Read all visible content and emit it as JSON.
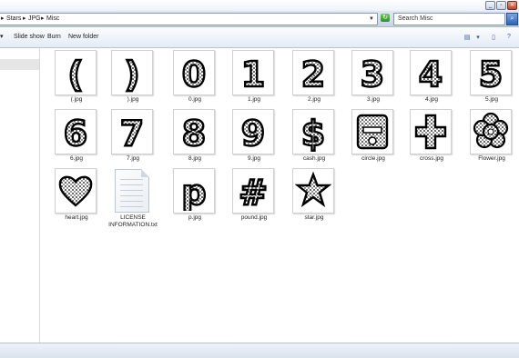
{
  "address": {
    "crumbs": [
      "Stars",
      "JPG",
      "Misc"
    ],
    "separator": "▸"
  },
  "search": {
    "placeholder": "Search Misc"
  },
  "toolbar": {
    "slideshow": "Slide show",
    "burn": "Burn",
    "new_folder": "New folder"
  },
  "files": [
    {
      "name": "(.jpg",
      "glyph": "("
    },
    {
      "name": ").jpg",
      "glyph": ")"
    },
    {
      "name": "0.jpg",
      "glyph": "0"
    },
    {
      "name": "1.jpg",
      "glyph": "1"
    },
    {
      "name": "2.jpg",
      "glyph": "2"
    },
    {
      "name": "3.jpg",
      "glyph": "3"
    },
    {
      "name": "4.jpg",
      "glyph": "4"
    },
    {
      "name": "5.jpg",
      "glyph": "5"
    },
    {
      "name": "6.jpg",
      "glyph": "6"
    },
    {
      "name": "7.jpg",
      "glyph": "7"
    },
    {
      "name": "8.jpg",
      "glyph": "8"
    },
    {
      "name": "9.jpg",
      "glyph": "9"
    },
    {
      "name": "cash.jpg",
      "glyph": "$"
    },
    {
      "name": "circle.jpg",
      "glyph": "circle-minus-icon"
    },
    {
      "name": "cross.jpg",
      "glyph": "cross-icon"
    },
    {
      "name": "Flower.jpg",
      "glyph": "flower-icon"
    },
    {
      "name": "heart.jpg",
      "glyph": "heart-icon"
    },
    {
      "name": "LICENSE INFORMATION.txt",
      "glyph": "text-document-icon"
    },
    {
      "name": "p.jpg",
      "glyph": "p"
    },
    {
      "name": "pound.jpg",
      "glyph": "#"
    },
    {
      "name": "star.jpg",
      "glyph": "star-icon"
    }
  ]
}
